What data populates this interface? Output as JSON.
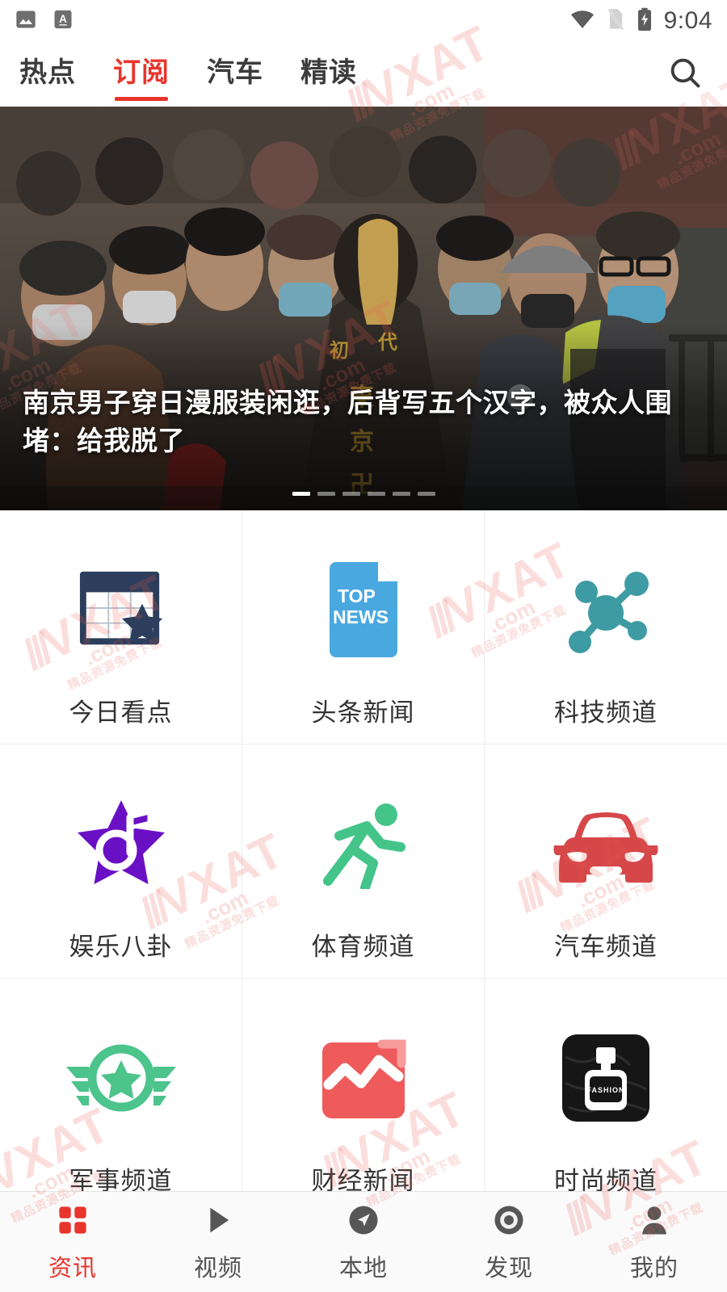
{
  "statusbar": {
    "time": "9:04",
    "icons_left": [
      "image-notification-icon",
      "input-method-icon"
    ],
    "icons_right": [
      "wifi-icon",
      "sim-card-off-icon",
      "battery-charging-icon"
    ]
  },
  "header": {
    "tabs": [
      {
        "label": "热点",
        "active": false
      },
      {
        "label": "订阅",
        "active": true
      },
      {
        "label": "汽车",
        "active": false
      },
      {
        "label": "精读",
        "active": false
      }
    ],
    "search_icon": "search-icon",
    "accent_color": "#e8352c"
  },
  "hero": {
    "title": "南京男子穿日漫服装闲逛，后背写五个汉字，被众人围堵：给我脱了",
    "dots_total": 6,
    "dots_active_index": 0
  },
  "channels": [
    {
      "label": "今日看点",
      "icon": "calendar-star-icon",
      "color": "#2c3e5b"
    },
    {
      "label": "头条新闻",
      "icon": "top-news-document-icon",
      "color": "#4aa8e0",
      "icon_text_line1": "TOP",
      "icon_text_line2": "NEWS"
    },
    {
      "label": "科技频道",
      "icon": "molecule-network-icon",
      "color": "#3f9ba3"
    },
    {
      "label": "娱乐八卦",
      "icon": "star-music-note-icon",
      "color": "#6a10c4"
    },
    {
      "label": "体育频道",
      "icon": "running-person-icon",
      "color": "#44c489"
    },
    {
      "label": "汽车频道",
      "icon": "car-front-icon",
      "color": "#d6474a"
    },
    {
      "label": "军事频道",
      "icon": "military-wings-star-icon",
      "color": "#4cc48c"
    },
    {
      "label": "财经新闻",
      "icon": "finance-chart-icon",
      "color": "#ef5a5a"
    },
    {
      "label": "时尚频道",
      "icon": "fashion-perfume-icon",
      "color": "#161616",
      "icon_text": "FASHION"
    }
  ],
  "bottomnav": {
    "items": [
      {
        "label": "资讯",
        "icon": "grid-squares-icon",
        "active": true
      },
      {
        "label": "视频",
        "icon": "play-triangle-icon",
        "active": false
      },
      {
        "label": "本地",
        "icon": "navigation-arrow-icon",
        "active": false
      },
      {
        "label": "发现",
        "icon": "target-circle-icon",
        "active": false
      },
      {
        "label": "我的",
        "icon": "person-avatar-icon",
        "active": false
      }
    ]
  },
  "watermark": {
    "slashes": "///",
    "text": "VXAT",
    "dotcom": ".com",
    "tiny": "精品资源免费下载"
  }
}
